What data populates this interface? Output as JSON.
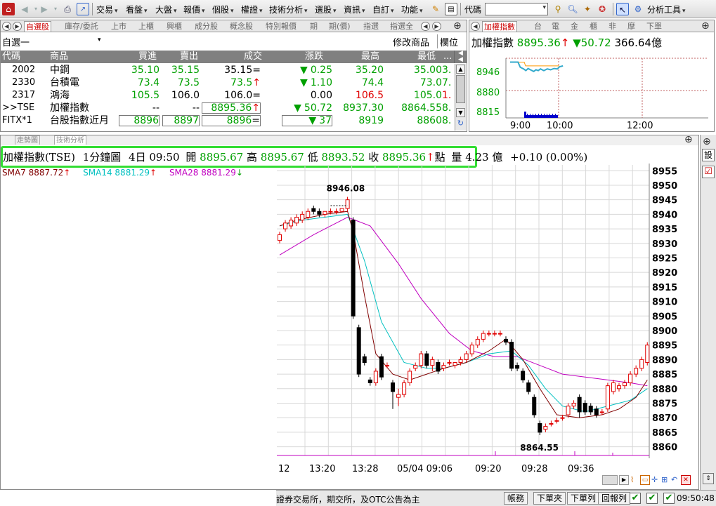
{
  "toolbar": {
    "menus": [
      "交易",
      "看盤",
      "大盤",
      "報價",
      "個股",
      "權證",
      "技術分析",
      "選股",
      "資訊",
      "自訂",
      "功能"
    ],
    "code_label": "代碼",
    "analysis_tools": "分析工具"
  },
  "watchlist": {
    "tabs": [
      "自選股",
      "庫存/委託",
      "上市",
      "上櫃",
      "興櫃",
      "成分股",
      "概念股",
      "特別報價",
      "期",
      "期(價)",
      "指選",
      "指選全"
    ],
    "group_name": "自選一",
    "modify_label": "修改商品",
    "column_label": "欄位",
    "headers": [
      "代碼",
      "商品",
      "買進",
      "賣出",
      "成交",
      "漲跌",
      "最高",
      "最低"
    ],
    "more_label": "...",
    "rows": [
      {
        "code": "2002",
        "name": "中鋼",
        "bid": "35.10",
        "ask": "35.15",
        "last": "35.15",
        "last_suffix": "=",
        "chg_arrow": "▼",
        "chg": "0.25",
        "high": "35.20",
        "low": "35.00",
        "low_tail": "3."
      },
      {
        "code": "2330",
        "name": "台積電",
        "bid": "73.4",
        "ask": "73.5",
        "last": "73.5",
        "last_suffix": "↑",
        "chg_arrow": "▼",
        "chg": "1.10",
        "high": "74.4",
        "low": "73.0",
        "low_tail": "7."
      },
      {
        "code": "2317",
        "name": "鴻海",
        "bid": "105.5",
        "ask": "106.0",
        "last": "106.0",
        "last_suffix": "=",
        "chg_arrow": "",
        "chg": "0.00",
        "high": "106.5",
        "low": "105.0",
        "low_tail": "1."
      },
      {
        "code": ">>TSE",
        "name": "加權指數",
        "bid": "--",
        "ask": "--",
        "last": "8895.36",
        "last_suffix": "↑",
        "chg_arrow": "▼",
        "chg": "50.72",
        "high": "8937.30",
        "low": "8864.55",
        "low_tail": "8."
      },
      {
        "code": "FITX*1",
        "name": "台股指數近月",
        "bid": "8896",
        "ask": "8897",
        "last": "8896",
        "last_suffix": "=",
        "chg_arrow": "▼",
        "chg": "37",
        "high": "8919",
        "low": "8860",
        "low_tail": "8."
      }
    ]
  },
  "mini": {
    "tabs": [
      "加權指數",
      "台",
      "電",
      "金",
      "櫃",
      "非",
      "摩",
      "下單"
    ],
    "title": "加權指數",
    "price": "8895.36",
    "price_arrow": "↑",
    "chg_arrow": "▼",
    "chg": "50.72",
    "volume": "366.64億",
    "y_labels": [
      "8946",
      "8880",
      "8815"
    ],
    "x_labels": [
      "9:00",
      "10:00",
      "12:00"
    ]
  },
  "main": {
    "tabs": [
      "走勢圖",
      "技術分析"
    ],
    "info": {
      "symbol": "加權指數(TSE)",
      "period": "1分鐘圖",
      "date_time": "4日 09:50",
      "open_label": "開",
      "open": "8895.67",
      "high_label": "高",
      "high": "8895.67",
      "low_label": "低",
      "low": "8893.52",
      "close_label": "收",
      "close": "8895.36",
      "close_arrow": "↑",
      "unit": "點",
      "vol_label": "量",
      "volume": "4.23 億",
      "change": "+0.10 (0.00%)"
    },
    "ma": [
      {
        "label": "SMA7 8887.72",
        "arrow": "↑",
        "color": "#800000"
      },
      {
        "label": "SMA14 8881.29",
        "arrow": "↑",
        "color": "#00c0c0"
      },
      {
        "label": "SMA28 8881.29",
        "arrow": "↓",
        "color": "#c000c0"
      }
    ],
    "annotations": {
      "high": "8946.08",
      "low": "8864.55"
    },
    "x_labels": [
      "12",
      "13:20",
      "13:28",
      "05/04 09:06",
      "09:20",
      "09:28",
      "09:36"
    ],
    "right_btn": "設"
  },
  "chart_data": {
    "type": "candlestick",
    "y_ticks": [
      8955,
      8950,
      8945,
      8940,
      8935,
      8930,
      8925,
      8920,
      8915,
      8910,
      8905,
      8900,
      8895,
      8890,
      8885,
      8880,
      8875,
      8870,
      8865,
      8860
    ],
    "ylim": [
      8857,
      8957
    ],
    "candles": [
      {
        "o": 8931,
        "h": 8934,
        "l": 8930,
        "c": 8933
      },
      {
        "o": 8935,
        "h": 8938,
        "l": 8934,
        "c": 8937
      },
      {
        "o": 8936,
        "h": 8939,
        "l": 8935,
        "c": 8938
      },
      {
        "o": 8937,
        "h": 8940,
        "l": 8936,
        "c": 8939
      },
      {
        "o": 8938,
        "h": 8941,
        "l": 8937,
        "c": 8940
      },
      {
        "o": 8939,
        "h": 8942,
        "l": 8938,
        "c": 8941
      },
      {
        "o": 8942,
        "h": 8943,
        "l": 8940,
        "c": 8941
      },
      {
        "o": 8941,
        "h": 8942,
        "l": 8939,
        "c": 8940
      },
      {
        "o": 8940,
        "h": 8941,
        "l": 8939,
        "c": 8941
      },
      {
        "o": 8941,
        "h": 8942,
        "l": 8940,
        "c": 8941
      },
      {
        "o": 8941,
        "h": 8942,
        "l": 8940,
        "c": 8941
      },
      {
        "o": 8941,
        "h": 8942,
        "l": 8941,
        "c": 8942
      },
      {
        "o": 8942,
        "h": 8946,
        "l": 8941,
        "c": 8945
      },
      {
        "o": 8938,
        "h": 8939,
        "l": 8904,
        "c": 8905
      },
      {
        "o": 8901,
        "h": 8902,
        "l": 8884,
        "c": 8885
      },
      {
        "o": 8891,
        "h": 8892,
        "l": 8888,
        "c": 8889
      },
      {
        "o": 8883,
        "h": 8884,
        "l": 8881,
        "c": 8882
      },
      {
        "o": 8882,
        "h": 8887,
        "l": 8881,
        "c": 8886
      },
      {
        "o": 8891,
        "h": 8892,
        "l": 8883,
        "c": 8884
      },
      {
        "o": 8888,
        "h": 8889,
        "l": 8887,
        "c": 8888
      },
      {
        "o": 8882,
        "h": 8883,
        "l": 8873,
        "c": 8879
      },
      {
        "o": 8877,
        "h": 8880,
        "l": 8874,
        "c": 8878
      },
      {
        "o": 8878,
        "h": 8883,
        "l": 8877,
        "c": 8882
      },
      {
        "o": 8882,
        "h": 8887,
        "l": 8881,
        "c": 8886
      },
      {
        "o": 8887,
        "h": 8889,
        "l": 8886,
        "c": 8888
      },
      {
        "o": 8888,
        "h": 8893,
        "l": 8887,
        "c": 8892
      },
      {
        "o": 8892,
        "h": 8893,
        "l": 8887,
        "c": 8888
      },
      {
        "o": 8888,
        "h": 8891,
        "l": 8886,
        "c": 8890
      },
      {
        "o": 8889,
        "h": 8890,
        "l": 8885,
        "c": 8886
      },
      {
        "o": 8887,
        "h": 8889,
        "l": 8886,
        "c": 8888
      },
      {
        "o": 8889,
        "h": 8890,
        "l": 8888,
        "c": 8889
      },
      {
        "o": 8888,
        "h": 8889,
        "l": 8887,
        "c": 8889
      },
      {
        "o": 8889,
        "h": 8891,
        "l": 8888,
        "c": 8890
      },
      {
        "o": 8890,
        "h": 8893,
        "l": 8889,
        "c": 8892
      },
      {
        "o": 8892,
        "h": 8896,
        "l": 8891,
        "c": 8895
      },
      {
        "o": 8895,
        "h": 8898,
        "l": 8894,
        "c": 8897
      },
      {
        "o": 8897,
        "h": 8900,
        "l": 8896,
        "c": 8899
      },
      {
        "o": 8899,
        "h": 8900,
        "l": 8898,
        "c": 8899
      },
      {
        "o": 8899,
        "h": 8900,
        "l": 8898,
        "c": 8899
      },
      {
        "o": 8899,
        "h": 8900,
        "l": 8898,
        "c": 8899
      },
      {
        "o": 8897,
        "h": 8898,
        "l": 8895,
        "c": 8896
      },
      {
        "o": 8896,
        "h": 8897,
        "l": 8886,
        "c": 8887
      },
      {
        "o": 8888,
        "h": 8889,
        "l": 8886,
        "c": 8887
      },
      {
        "o": 8886,
        "h": 8887,
        "l": 8882,
        "c": 8883
      },
      {
        "o": 8882,
        "h": 8883,
        "l": 8878,
        "c": 8879
      },
      {
        "o": 8877,
        "h": 8878,
        "l": 8870,
        "c": 8871
      },
      {
        "o": 8868,
        "h": 8869,
        "l": 8864,
        "c": 8865
      },
      {
        "o": 8866,
        "h": 8868,
        "l": 8865,
        "c": 8867
      },
      {
        "o": 8868,
        "h": 8869,
        "l": 8867,
        "c": 8868
      },
      {
        "o": 8869,
        "h": 8870,
        "l": 8868,
        "c": 8869
      },
      {
        "o": 8870,
        "h": 8871,
        "l": 8869,
        "c": 8870
      },
      {
        "o": 8871,
        "h": 8875,
        "l": 8870,
        "c": 8874
      },
      {
        "o": 8874,
        "h": 8876,
        "l": 8873,
        "c": 8875
      },
      {
        "o": 8877,
        "h": 8878,
        "l": 8870,
        "c": 8872
      },
      {
        "o": 8875,
        "h": 8876,
        "l": 8871,
        "c": 8872
      },
      {
        "o": 8874,
        "h": 8875,
        "l": 8871,
        "c": 8872
      },
      {
        "o": 8873,
        "h": 8874,
        "l": 8870,
        "c": 8871
      },
      {
        "o": 8872,
        "h": 8873,
        "l": 8871,
        "c": 8872
      },
      {
        "o": 8873,
        "h": 8882,
        "l": 8872,
        "c": 8881
      },
      {
        "o": 8879,
        "h": 8883,
        "l": 8878,
        "c": 8882
      },
      {
        "o": 8880,
        "h": 8882,
        "l": 8879,
        "c": 8881
      },
      {
        "o": 8881,
        "h": 8883,
        "l": 8880,
        "c": 8882
      },
      {
        "o": 8882,
        "h": 8886,
        "l": 8881,
        "c": 8885
      },
      {
        "o": 8885,
        "h": 8888,
        "l": 8884,
        "c": 8887
      },
      {
        "o": 8887,
        "h": 8891,
        "l": 8886,
        "c": 8890
      },
      {
        "o": 8889,
        "h": 8896,
        "l": 8888,
        "c": 8895
      }
    ],
    "sma7": [
      [
        0,
        8936
      ],
      [
        3,
        8938
      ],
      [
        8,
        8940
      ],
      [
        12,
        8941
      ],
      [
        13,
        8934
      ],
      [
        15,
        8912
      ],
      [
        17,
        8892
      ],
      [
        20,
        8885
      ],
      [
        23,
        8883
      ],
      [
        26,
        8885
      ],
      [
        29,
        8887
      ],
      [
        33,
        8889
      ],
      [
        37,
        8893
      ],
      [
        40,
        8897
      ],
      [
        43,
        8890
      ],
      [
        46,
        8880
      ],
      [
        49,
        8871
      ],
      [
        53,
        8870
      ],
      [
        57,
        8871
      ],
      [
        60,
        8873
      ],
      [
        63,
        8877
      ],
      [
        65,
        8883
      ]
    ],
    "sma14": [
      [
        0,
        8936
      ],
      [
        4,
        8938
      ],
      [
        8,
        8939
      ],
      [
        12,
        8940
      ],
      [
        15,
        8924
      ],
      [
        18,
        8903
      ],
      [
        22,
        8889
      ],
      [
        26,
        8887
      ],
      [
        29,
        8887
      ],
      [
        33,
        8889
      ],
      [
        37,
        8892
      ],
      [
        41,
        8893
      ],
      [
        44,
        8888
      ],
      [
        47,
        8880
      ],
      [
        50,
        8874
      ],
      [
        54,
        8872
      ],
      [
        58,
        8874
      ],
      [
        62,
        8876
      ],
      [
        65,
        8880
      ]
    ],
    "sma28": [
      [
        0,
        8926
      ],
      [
        6,
        8933
      ],
      [
        12,
        8939
      ],
      [
        16,
        8936
      ],
      [
        21,
        8923
      ],
      [
        25,
        8911
      ],
      [
        30,
        8899
      ],
      [
        34,
        8893
      ],
      [
        38,
        8891
      ],
      [
        42,
        8891
      ],
      [
        46,
        8888
      ],
      [
        50,
        8885
      ],
      [
        54,
        8884
      ],
      [
        58,
        8883
      ],
      [
        62,
        8882
      ],
      [
        65,
        8881
      ]
    ],
    "mini_line": [
      [
        0,
        8946
      ],
      [
        7,
        8946
      ],
      [
        9,
        8934
      ],
      [
        12,
        8930
      ],
      [
        14,
        8926
      ],
      [
        16,
        8931
      ],
      [
        18,
        8928
      ],
      [
        21,
        8924
      ],
      [
        23,
        8928
      ],
      [
        25,
        8926
      ],
      [
        27,
        8930
      ],
      [
        30,
        8926
      ],
      [
        33,
        8930
      ],
      [
        36,
        8928
      ],
      [
        39,
        8931
      ],
      [
        42,
        8930
      ],
      [
        44,
        8935
      ],
      [
        47,
        8937
      ]
    ],
    "mini_ylim": [
      8815,
      8955
    ]
  },
  "status": {
    "text": "證券交易所，期交所，及OTC公告為主",
    "buttons": [
      "帳務",
      "下單夾",
      "下單列",
      "回報列"
    ],
    "time": "09:50:48"
  }
}
